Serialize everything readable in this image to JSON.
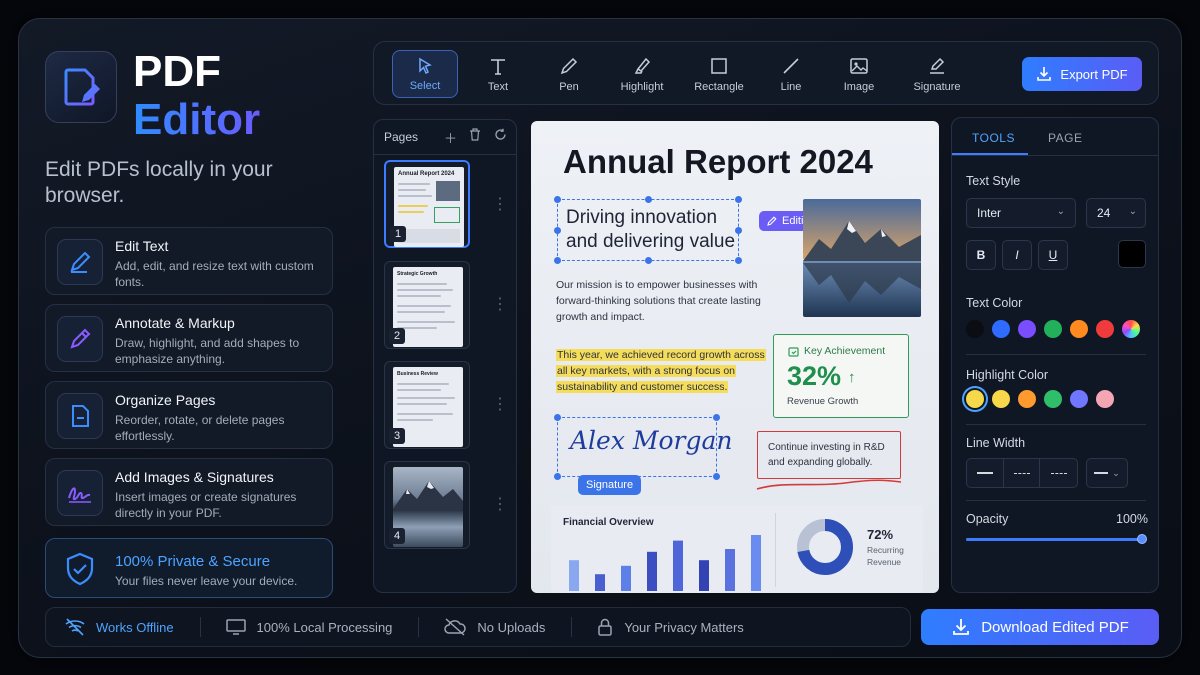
{
  "brand": {
    "line1": "PDF",
    "line2": "Editor",
    "tagline": "Edit PDFs locally in your browser."
  },
  "features": [
    {
      "title": "Edit Text",
      "desc": "Add, edit, and resize text with custom fonts.",
      "icon": "pencil-icon"
    },
    {
      "title": "Annotate & Markup",
      "desc": "Draw, highlight, and add shapes to emphasize anything.",
      "icon": "pen-icon"
    },
    {
      "title": "Organize Pages",
      "desc": "Reorder, rotate, or delete pages effortlessly.",
      "icon": "page-icon"
    },
    {
      "title": "Add Images & Signatures",
      "desc": "Insert images or create signatures directly in your PDF.",
      "icon": "signature-icon"
    },
    {
      "title": "100% Private & Secure",
      "desc": "Your files never leave your device.",
      "icon": "shield-icon"
    }
  ],
  "bottombar": {
    "offline": "Works Offline",
    "local": "100% Local Processing",
    "uploads": "No Uploads",
    "privacy": "Your Privacy Matters",
    "download": "Download Edited PDF"
  },
  "toolbar": {
    "tools": [
      "Select",
      "Text",
      "Pen",
      "Highlight",
      "Rectangle",
      "Line",
      "Image",
      "Signature"
    ],
    "export": "Export PDF"
  },
  "pages": {
    "header": "Pages",
    "numbers": [
      "1",
      "2",
      "3",
      "4"
    ],
    "thumb1_title": "Annual Report 2024",
    "thumb2_title": "Strategic Growth",
    "thumb3_title": "Business Review"
  },
  "doc": {
    "title": "Annual Report 2024",
    "heading_line1": "Driving innovation",
    "heading_line2": "and delivering value",
    "editing_tag": "Editing Text",
    "mission": "Our mission is to empower businesses with forward-thinking solutions that create lasting growth and impact.",
    "highlight": "This year, we achieved record growth across all key markets, with a strong focus on sustainability and customer success.",
    "achievement": {
      "label": "Key Achievement",
      "value": "32%",
      "caption": "Revenue Growth"
    },
    "signature_name": "Alex Morgan",
    "signature_tag": "Signature",
    "note": "Continue investing in R&D and expanding globally.",
    "financial": {
      "title": "Financial Overview",
      "pct": "72%",
      "caption1": "Recurring",
      "caption2": "Revenue",
      "donut_fraction": 0.72,
      "bars": [
        0.55,
        0.3,
        0.45,
        0.7,
        0.9,
        0.55,
        0.75,
        1.0
      ]
    }
  },
  "panel": {
    "tab_tools": "TOOLS",
    "tab_page": "PAGE",
    "text_style": "Text Style",
    "font": "Inter",
    "size": "24",
    "bold": "B",
    "italic": "I",
    "underline": "U",
    "text_color": "Text Color",
    "highlight_color": "Highlight Color",
    "line_width": "Line Width",
    "opacity": "Opacity",
    "opacity_value": "100%",
    "opacity_fraction": 1.0,
    "text_colors": [
      "#0b0d12",
      "#2f6bff",
      "#7a4dff",
      "#22b05b",
      "#ff8a1f",
      "#ef3b3b"
    ],
    "highlight_colors": [
      "#f6d84a",
      "#f6d84a",
      "#ff9a2e",
      "#2fbf6a",
      "#6f76ff",
      "#f4a6b4"
    ],
    "current_color": "#000000",
    "accent": "#2f7dff"
  }
}
